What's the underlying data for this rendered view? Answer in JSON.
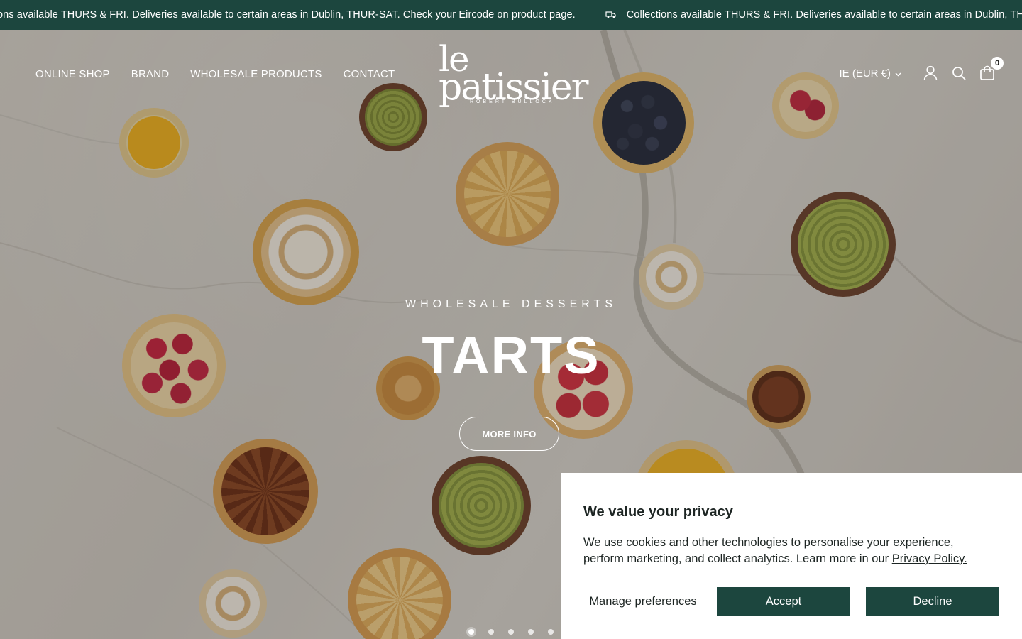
{
  "announcement": {
    "message": "Collections available THURS & FRI. Deliveries available to certain areas in Dublin, THUR-SAT. Check your Eircode on product page.",
    "message_partial_left": "ons available THURS & FRI. Deliveries available to certain areas in Dublin, THUR-SAT. Check your Eircode on product page.",
    "icon": "truck-icon",
    "background": "#1c463e"
  },
  "header": {
    "nav": [
      "ONLINE SHOP",
      "BRAND",
      "WHOLESALE PRODUCTS",
      "CONTACT"
    ],
    "logo": {
      "line1": "le",
      "line2": "patissier",
      "sub": "ROBERT BULLOCK"
    },
    "currency": "IE (EUR €)",
    "cart_count": "0",
    "icons": [
      "account-icon",
      "search-icon",
      "cart-icon"
    ]
  },
  "hero": {
    "subheading": "WHOLESALE DESSERTS",
    "title": "TARTS",
    "button": "MORE INFO",
    "slides": 5,
    "active_slide": 1
  },
  "cookie": {
    "title": "We value your privacy",
    "body": "We use cookies and other technologies to personalise your experience, perform marketing, and collect analytics. Learn more in our ",
    "link": "Privacy Policy.",
    "manage": "Manage preferences",
    "accept": "Accept",
    "decline": "Decline",
    "accent": "#1c463e"
  }
}
